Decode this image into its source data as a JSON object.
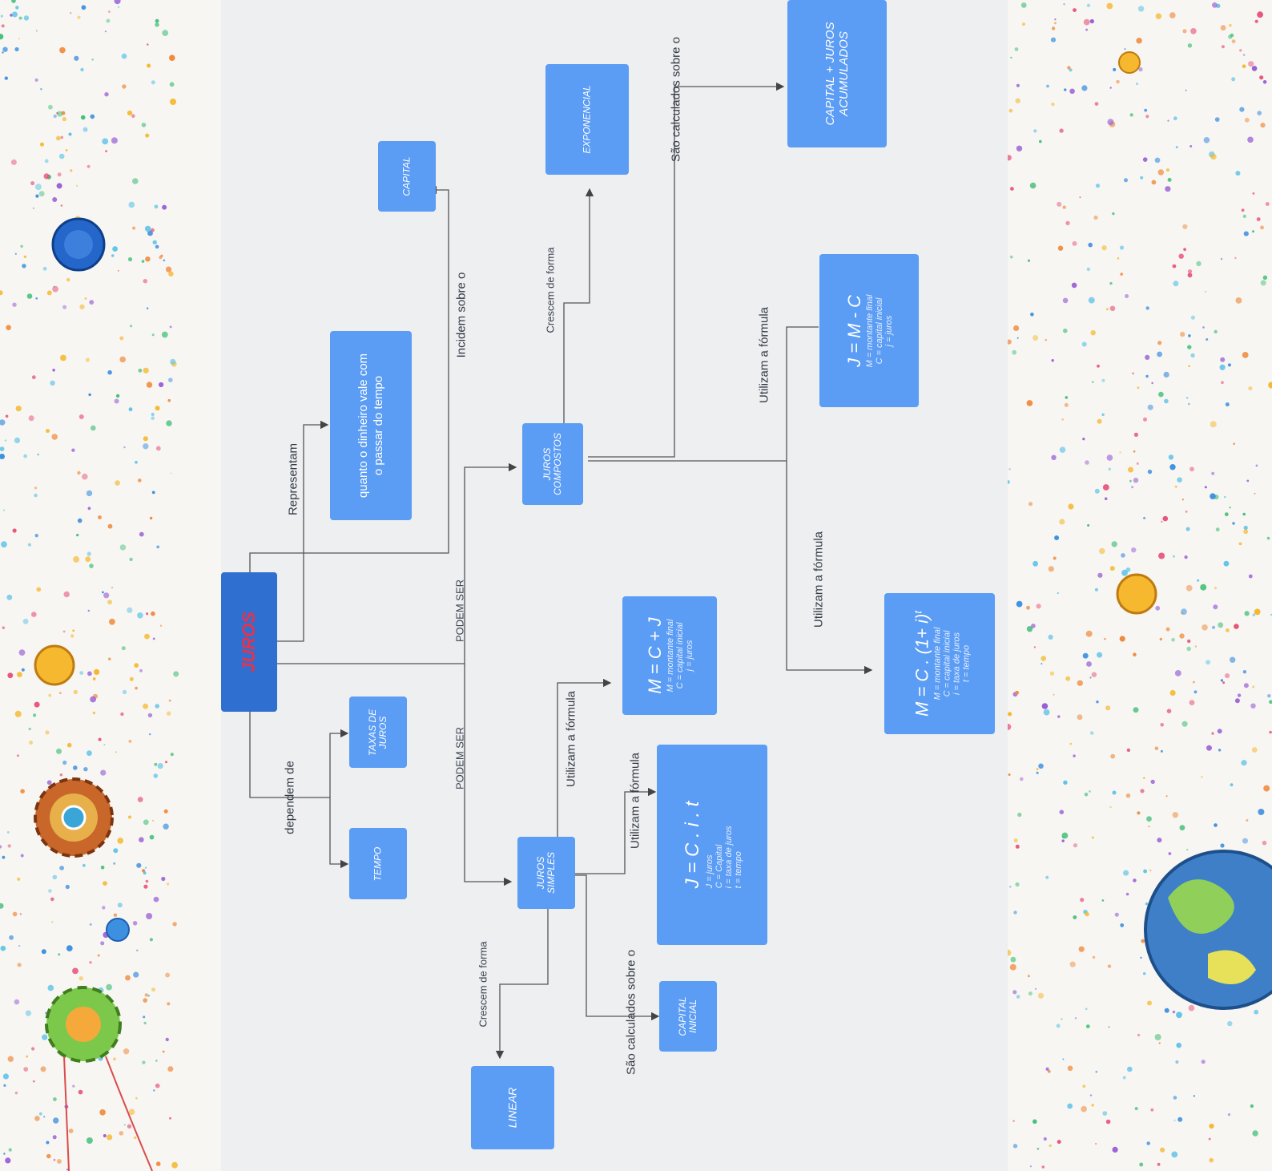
{
  "diagram": {
    "center": "JUROS",
    "nodes": {
      "capital": "CAPITAL",
      "representa": {
        "line1": "quanto o dinheiro vale com",
        "line2": "o passar do tempo"
      },
      "taxas": {
        "line1": "TAXAS DE",
        "line2": "JUROS"
      },
      "tempo": "TEMPO",
      "compostos": {
        "line1": "JUROS",
        "line2": "COMPOSTOS"
      },
      "simples": {
        "line1": "JUROS",
        "line2": "SIMPLES"
      },
      "exponencial": "EXPONENCIAL",
      "acumulados": {
        "line1": "CAPITAL  + JUROS",
        "line2": "ACUMULADOS"
      },
      "f_jmc": {
        "formula": "J = M - C",
        "l1": "M = montante final",
        "l2": "C = capital inicial",
        "l3": "j = juros"
      },
      "f_mcj": {
        "formula": "M = C + J",
        "l1": "M = montante final",
        "l2": "C = capital inicial",
        "l3": "j = juros"
      },
      "f_composto": {
        "formula": "M = C . (1+ i)",
        "exp": "t",
        "l1": "M = montante final",
        "l2": "C = capital inicial",
        "l3": "i = taxa de juros",
        "l4": "t = tempo"
      },
      "f_jcit": {
        "formula": "J = C . i . t",
        "l1": "J = juros",
        "l2": "C = Capital",
        "l3": "i = taxa de juros",
        "l4": "t = tempo"
      },
      "capital_inicial": {
        "line1": "CAPITAL",
        "line2": "INICIAL"
      },
      "linear": "LINEAR"
    },
    "labels": {
      "representam": "Representam",
      "incidem": "Incidem sobre o",
      "dependem": "dependem de",
      "podem_ser_1": "PODEM SER",
      "podem_ser_2": "PODEM SER",
      "crescem_comp": "Crescem de forma",
      "calc_comp": "São calculados sobre o",
      "formula_1": "Utilizam a fórmula",
      "formula_2": "Utilizam a fórmula",
      "formula_3": "Utilizam a fórmula",
      "formula_4": "Utilizam a fórmula",
      "calc_simp": "São calculados sobre o",
      "crescem_simp": "Crescem de forma"
    }
  },
  "colors": {
    "node": "#5b9cf5",
    "center": "#2f6fcf",
    "center_text": "#e8324a",
    "board": "#eeeff1"
  }
}
